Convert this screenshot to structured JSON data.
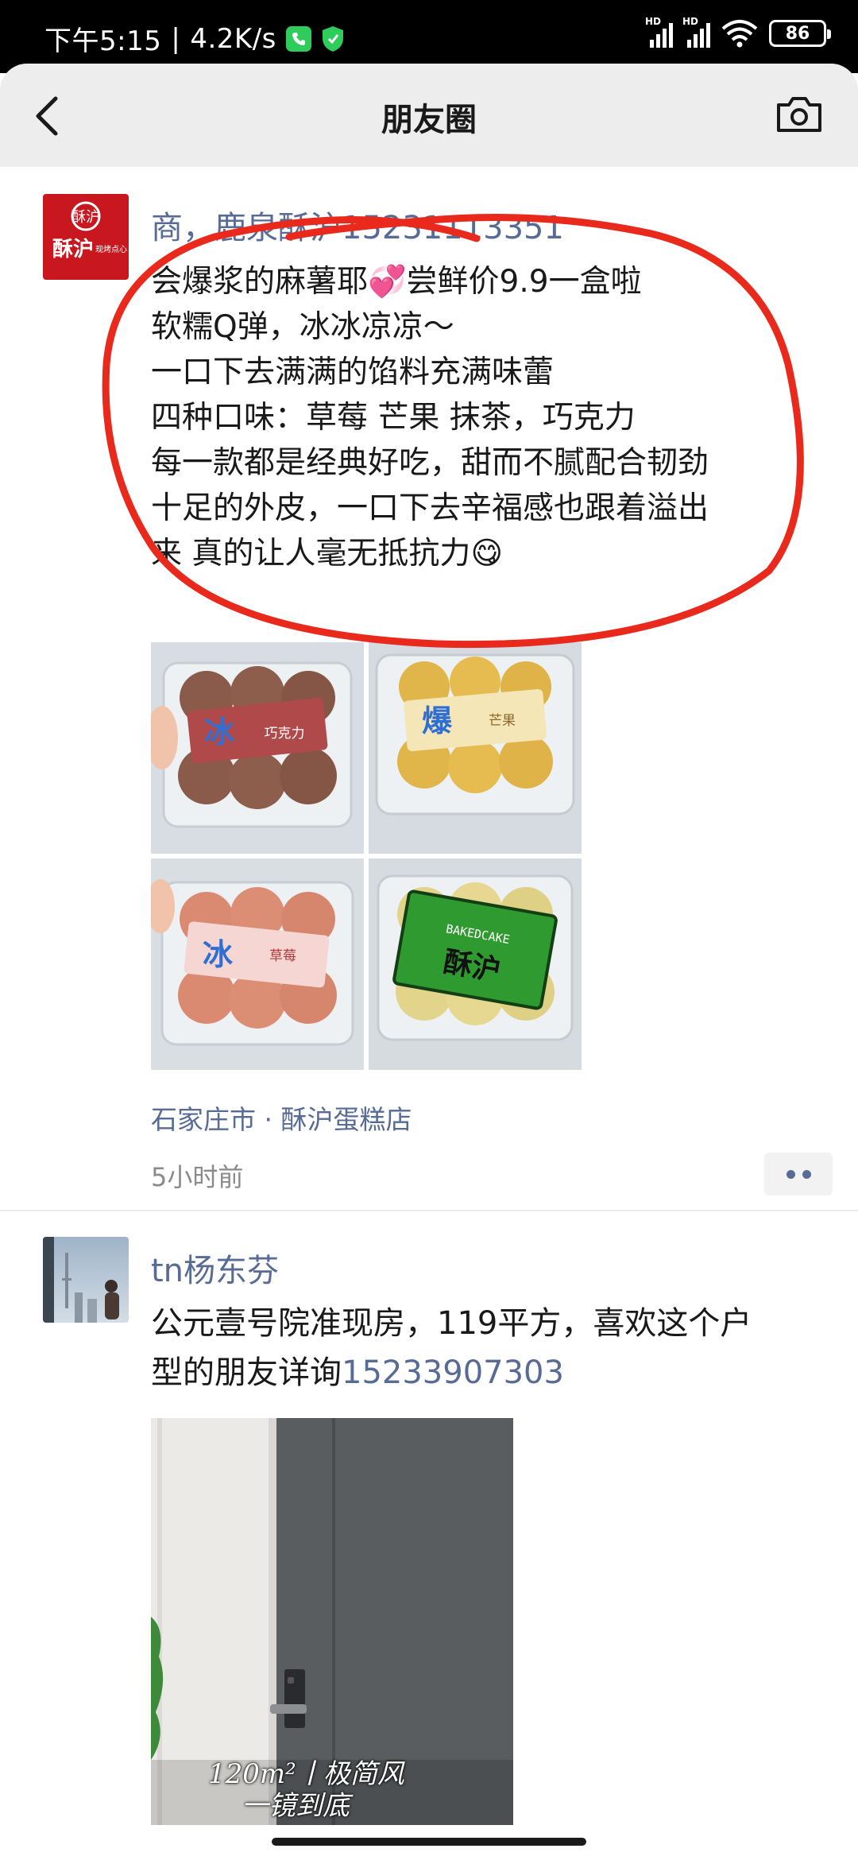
{
  "status_bar": {
    "time": "下午5:15",
    "net_speed": "4.2K/s",
    "network_type": "HD",
    "battery": "86"
  },
  "header": {
    "title": "朋友圈"
  },
  "posts": [
    {
      "avatar_text": "酥沪",
      "avatar_sub": "现烤点心",
      "author": "商，鹿泉酥沪15231113351",
      "lines": [
        "会爆浆的麻薯耶💞尝鲜价9.9一盒啦",
        "软糯Q弹，冰冰凉凉～",
        "一口下去满满的馅料充满味蕾",
        "四种口味：草莓 芒果 抹茶，巧克力",
        "每一款都是经典好吃，甜而不腻配合韧劲",
        "十足的外皮，一口下去辛福感也跟着溢出",
        "来 真的让人毫无抵抗力😋"
      ],
      "images": [
        {
          "label": "冰",
          "sub": "巧克力"
        },
        {
          "label": "爆",
          "sub": "芒果"
        },
        {
          "label": "冰",
          "sub": "草莓"
        },
        {
          "label": "酥沪",
          "sub": "BAKEDCAKE"
        }
      ],
      "location": "石家庄市 · 酥沪蛋糕店",
      "time": "5小时前"
    },
    {
      "author": "tn杨东芬",
      "text_line1": "公元壹号院准现房，119平方，喜欢这个户",
      "text_line2_prefix": "型的朋友详询",
      "phone": "15233907303",
      "video_caption_1": "120m²丨极简风",
      "video_caption_2": "一镜到底"
    }
  ],
  "colors": {
    "link": "#576b95",
    "header_bg": "#ededed",
    "annotation": "#e8291c"
  }
}
